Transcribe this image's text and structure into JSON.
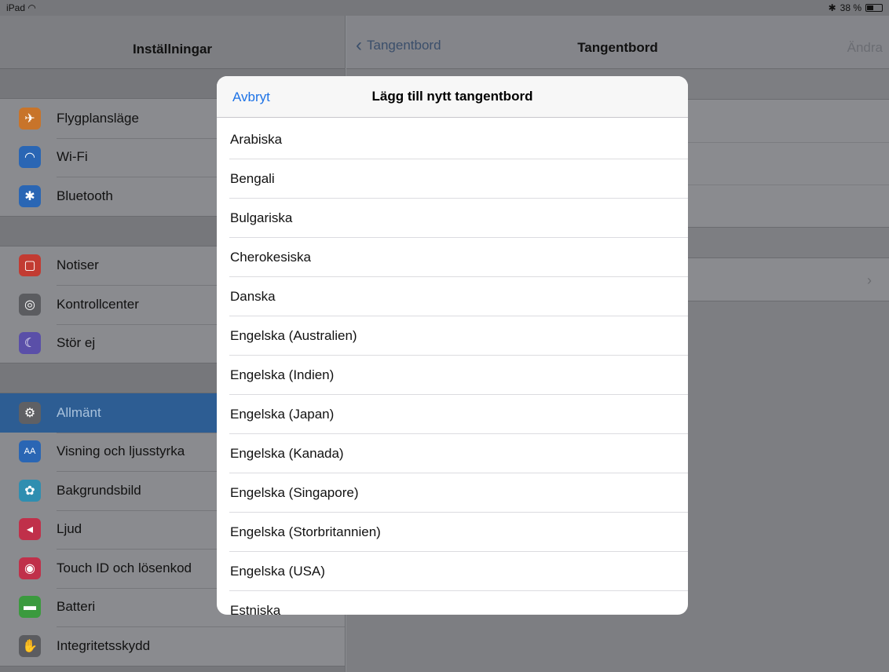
{
  "status": {
    "device": "iPad",
    "wifi_icon": "wifi-icon",
    "bluetooth_icon": "bluetooth-icon",
    "battery": "38 %"
  },
  "master": {
    "title": "Inställningar",
    "groups": [
      {
        "items": [
          {
            "label": "Flygplansläge",
            "icon": "airplane-icon",
            "color": "#c8742a"
          },
          {
            "label": "Wi-Fi",
            "icon": "wifi-icon",
            "color": "#2a66b4"
          },
          {
            "label": "Bluetooth",
            "icon": "bluetooth-icon",
            "color": "#2a66b4"
          }
        ]
      },
      {
        "items": [
          {
            "label": "Notiser",
            "icon": "notifications-icon",
            "color": "#c23b32"
          },
          {
            "label": "Kontrollcenter",
            "icon": "control-center-icon",
            "color": "#5b5c60"
          },
          {
            "label": "Stör ej",
            "icon": "moon-icon",
            "color": "#5a4fa8"
          }
        ]
      },
      {
        "items": [
          {
            "label": "Allmänt",
            "icon": "gear-icon",
            "color": "#5f6064",
            "selected": true
          },
          {
            "label": "Visning och ljusstyrka",
            "icon": "display-icon",
            "color": "#2a66b4"
          },
          {
            "label": "Bakgrundsbild",
            "icon": "wallpaper-icon",
            "color": "#2f8eb0"
          },
          {
            "label": "Ljud",
            "icon": "sound-icon",
            "color": "#c0304a"
          },
          {
            "label": "Touch ID och lösenkod",
            "icon": "fingerprint-icon",
            "color": "#c0304a"
          },
          {
            "label": "Batteri",
            "icon": "battery-icon",
            "color": "#3b9a3e"
          },
          {
            "label": "Integritetsskydd",
            "icon": "hand-icon",
            "color": "#5b5c60"
          }
        ]
      }
    ]
  },
  "detail": {
    "back_label": "Tangentbord",
    "title": "Tangentbord",
    "edit_label": "Ändra"
  },
  "modal": {
    "cancel_label": "Avbryt",
    "title": "Lägg till nytt tangentbord",
    "languages": [
      "Arabiska",
      "Bengali",
      "Bulgariska",
      "Cherokesiska",
      "Danska",
      "Engelska (Australien)",
      "Engelska (Indien)",
      "Engelska (Japan)",
      "Engelska (Kanada)",
      "Engelska (Singapore)",
      "Engelska (Storbritannien)",
      "Engelska (USA)",
      "Estniska"
    ]
  }
}
